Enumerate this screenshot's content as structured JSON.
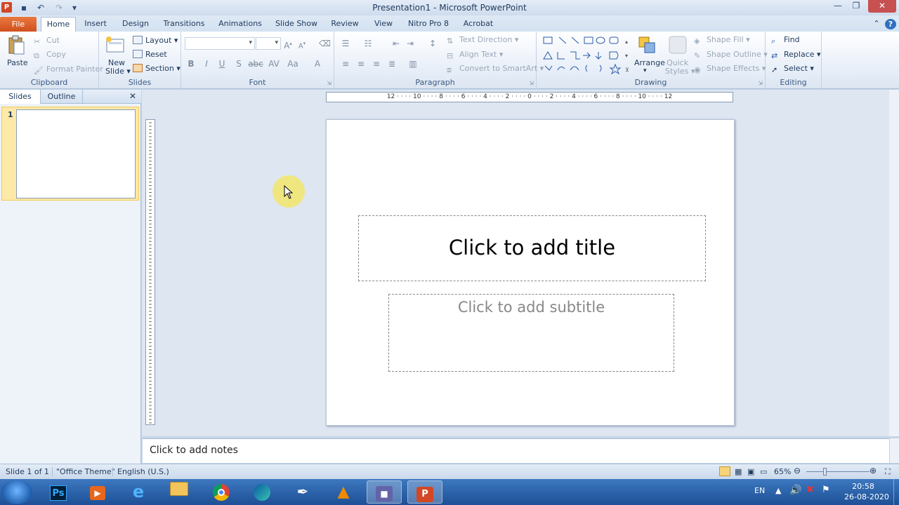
{
  "window": {
    "title": "Presentation1  -  Microsoft PowerPoint"
  },
  "tabs": [
    "File",
    "Home",
    "Insert",
    "Design",
    "Transitions",
    "Animations",
    "Slide Show",
    "Review",
    "View",
    "Nitro Pro 8",
    "Acrobat"
  ],
  "clipboard": {
    "paste": "Paste",
    "cut": "Cut",
    "copy": "Copy",
    "format_painter": "Format Painter",
    "label": "Clipboard"
  },
  "slides_group": {
    "new_slide_1": "New",
    "new_slide_2": "Slide",
    "layout": "Layout",
    "reset": "Reset",
    "section": "Section",
    "label": "Slides"
  },
  "font_group": {
    "label": "Font",
    "bold": "B",
    "italic": "I",
    "underline": "U",
    "strike": "S",
    "shadow": "abc",
    "spacing": "AV",
    "case": "Aa",
    "color": "A"
  },
  "paragraph_group": {
    "text_direction": "Text Direction",
    "align_text": "Align Text",
    "smartart": "Convert to SmartArt",
    "label": "Paragraph"
  },
  "drawing_group": {
    "arrange": "Arrange",
    "quick_styles_1": "Quick",
    "quick_styles_2": "Styles",
    "shape_fill": "Shape Fill",
    "shape_outline": "Shape Outline",
    "shape_effects": "Shape Effects",
    "label": "Drawing"
  },
  "editing_group": {
    "find": "Find",
    "replace": "Replace",
    "select": "Select",
    "label": "Editing"
  },
  "left_panel": {
    "tab_slides": "Slides",
    "tab_outline": "Outline",
    "slide_number": "1"
  },
  "hruler_text": "12 · · · · 10 · · · · 8 · · · · 6 · · · · 4 · · · · 2 · · · · 0 · · · · 2 · · · · 4 · · · · 6 · · · · 8 · · · · 10 · · · · 12",
  "slide": {
    "title_placeholder": "Click to add title",
    "subtitle_placeholder": "Click to add subtitle"
  },
  "notes_placeholder": "Click to add notes",
  "status": {
    "slide": "Slide 1 of 1",
    "theme": "\"Office Theme\"",
    "language": "English (U.S.)",
    "zoom": "65%"
  },
  "taskbar": {
    "lang": "EN",
    "time": "20:58",
    "date": "26-08-2020"
  },
  "colors": {
    "file_tab": "#d0501d",
    "accent": "#1e395b",
    "taskbar": "#1d4f95"
  }
}
